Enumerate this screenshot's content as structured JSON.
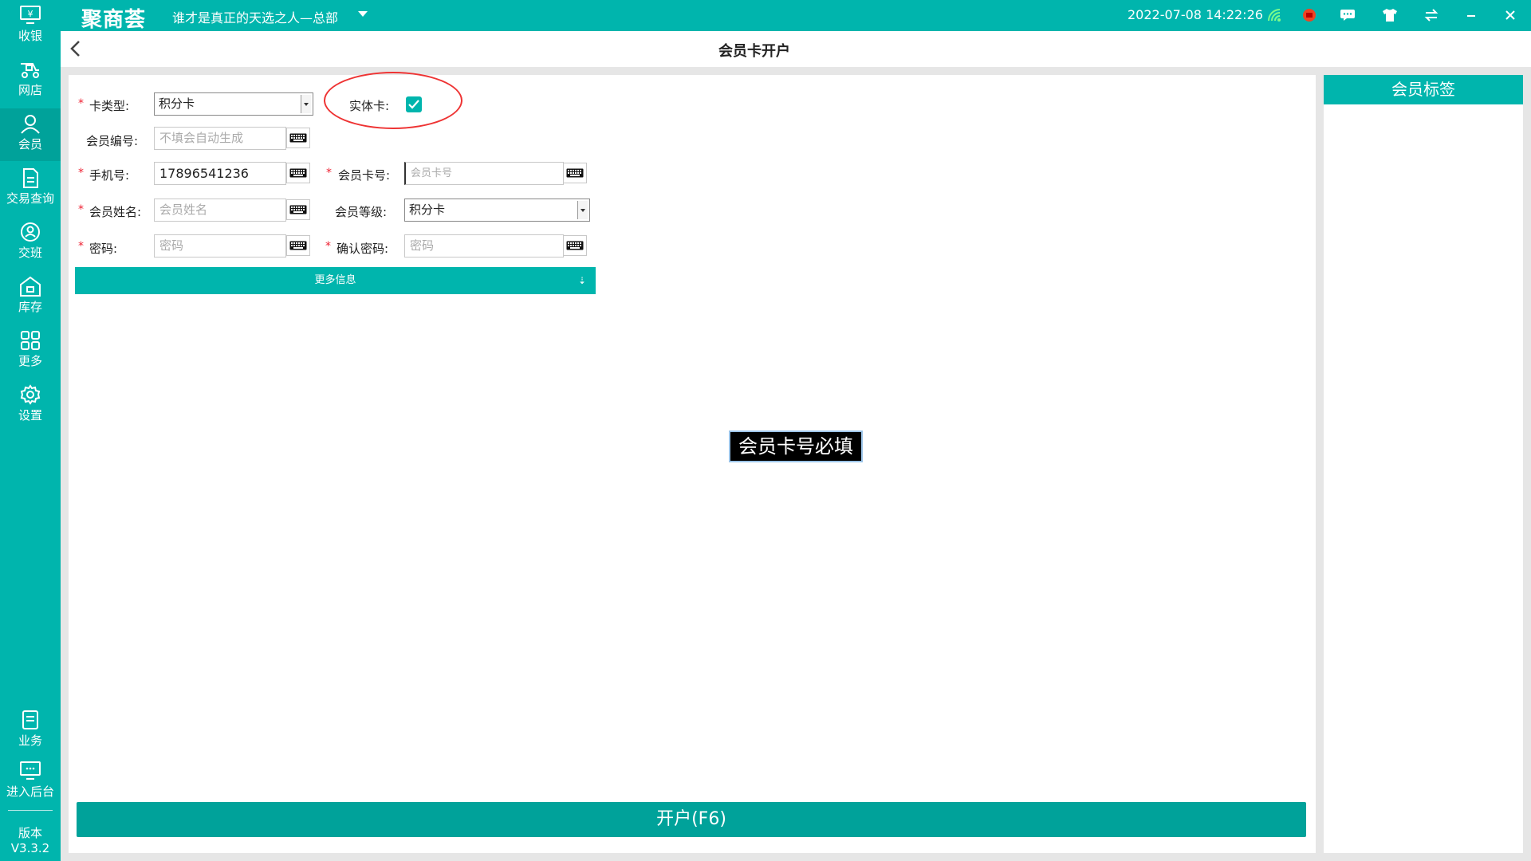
{
  "header": {
    "brand": "聚商荟",
    "store": "谁才是真正的天选之人—总部",
    "datetime": "2022-07-08 14:22:26"
  },
  "sidebar": {
    "items": [
      {
        "label": "收银",
        "icon": "cashier-icon"
      },
      {
        "label": "网店",
        "icon": "online-store-icon"
      },
      {
        "label": "会员",
        "icon": "member-icon"
      },
      {
        "label": "交易查询",
        "icon": "transaction-icon"
      },
      {
        "label": "交班",
        "icon": "shift-icon"
      },
      {
        "label": "库存",
        "icon": "inventory-icon"
      },
      {
        "label": "更多",
        "icon": "more-grid-icon"
      },
      {
        "label": "设置",
        "icon": "gear-icon"
      },
      {
        "label": "业务",
        "icon": "business-icon"
      },
      {
        "label": "进入后台",
        "icon": "backend-icon"
      }
    ],
    "version_label": "版本",
    "version": "V3.3.2"
  },
  "page": {
    "title": "会员卡开户"
  },
  "form": {
    "card_type": {
      "label": "卡类型:",
      "value": "积分卡"
    },
    "physical_card": {
      "label": "实体卡:",
      "checked": true
    },
    "member_no": {
      "label": "会员编号:",
      "placeholder": "不填会自动生成"
    },
    "phone": {
      "label": "手机号:",
      "value": "17896541236"
    },
    "card_no": {
      "label": "会员卡号:",
      "placeholder": "会员卡号"
    },
    "name": {
      "label": "会员姓名:",
      "placeholder": "会员姓名"
    },
    "level": {
      "label": "会员等级:",
      "value": "积分卡"
    },
    "password": {
      "label": "密码:",
      "placeholder": "密码"
    },
    "confirm_password": {
      "label": "确认密码:",
      "placeholder": "密码"
    },
    "more_info": "更多信息",
    "required_mark": "*"
  },
  "toast": "会员卡号必填",
  "submit": "开户(F6)",
  "right_panel": {
    "title": "会员标签"
  },
  "colors": {
    "accent": "#00b5ad",
    "button": "#00a29a",
    "required": "#ee2233",
    "highlight": "#ee3333"
  }
}
